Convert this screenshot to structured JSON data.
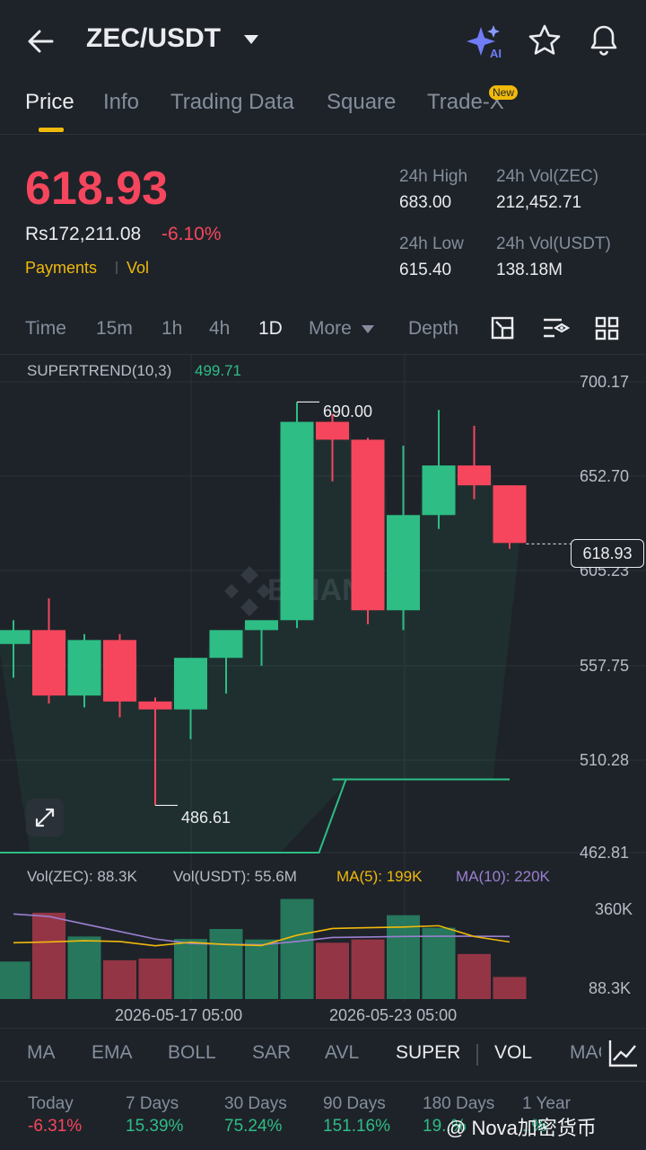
{
  "header": {
    "pair": "ZEC/USDT"
  },
  "tabs": [
    {
      "label": "Price",
      "active": true
    },
    {
      "label": "Info"
    },
    {
      "label": "Trading Data"
    },
    {
      "label": "Square"
    },
    {
      "label": "Trade-X",
      "badge": "New"
    }
  ],
  "summary": {
    "price": "618.93",
    "fiat": "Rs172,211.08",
    "change": "-6.10%",
    "tag_payments": "Payments",
    "tag_vol": "Vol",
    "stats": [
      {
        "label": "24h High",
        "value": "683.00"
      },
      {
        "label": "24h Vol(ZEC)",
        "value": "212,452.71"
      },
      {
        "label": "24h Low",
        "value": "615.40"
      },
      {
        "label": "24h Vol(USDT)",
        "value": "138.18M"
      }
    ]
  },
  "timeframes": [
    "Time",
    "15m",
    "1h",
    "4h",
    "1D",
    "More",
    "Depth"
  ],
  "active_timeframe": "1D",
  "chart": {
    "supertrend_label": "SUPERTREND(10,3)",
    "supertrend_value": "499.71",
    "price_ticks": [
      "700.17",
      "652.70",
      "605.23",
      "557.75",
      "510.28",
      "462.81"
    ],
    "current_price_label": "618.93",
    "high_label": "690.00",
    "low_label": "486.61",
    "watermark": "BINANCE",
    "vol_zec": "Vol(ZEC): 88.3K",
    "vol_usdt": "Vol(USDT): 55.6M",
    "ma5": "MA(5): 199K",
    "ma10": "MA(10): 220K",
    "vol_ticks": [
      "360K",
      "88.3K"
    ],
    "dates": [
      "2026-05-17 05:00",
      "2026-05-23 05:00"
    ],
    "colors": {
      "up": "#2ebd85",
      "down": "#f6465d",
      "ma5": "#f0b90b",
      "ma10": "#9b7fd1"
    }
  },
  "chart_data": {
    "type": "candlestick",
    "ylim": [
      462.81,
      700.17
    ],
    "candles": [
      {
        "o": 568,
        "h": 580,
        "l": 551,
        "c": 575
      },
      {
        "o": 575,
        "h": 591,
        "l": 538,
        "c": 542
      },
      {
        "o": 542,
        "h": 573,
        "l": 536,
        "c": 570
      },
      {
        "o": 570,
        "h": 573,
        "l": 531,
        "c": 539
      },
      {
        "o": 539,
        "h": 541,
        "l": 486.61,
        "c": 535
      },
      {
        "o": 535,
        "h": 556,
        "l": 520,
        "c": 561
      },
      {
        "o": 561,
        "h": 570,
        "l": 543,
        "c": 575
      },
      {
        "o": 575,
        "h": 579,
        "l": 557,
        "c": 580
      },
      {
        "o": 580,
        "h": 690.0,
        "l": 576,
        "c": 680
      },
      {
        "o": 680,
        "h": 684,
        "l": 650,
        "c": 671
      },
      {
        "o": 671,
        "h": 672,
        "l": 578,
        "c": 585
      },
      {
        "o": 585,
        "h": 668,
        "l": 575,
        "c": 633
      },
      {
        "o": 633,
        "h": 686,
        "l": 626,
        "c": 658
      },
      {
        "o": 658,
        "h": 678,
        "l": 641,
        "c": 648
      },
      {
        "o": 648,
        "h": 648,
        "l": 616,
        "c": 618.93
      }
    ],
    "supertrend": [
      462.81,
      462.81,
      462.81,
      462.81,
      462.81,
      462.81,
      462.81,
      462.81,
      462.81,
      499.71,
      499.71,
      499.71,
      499.71,
      499.71,
      499.71
    ],
    "volume_ylim": [
      0,
      420000
    ],
    "volumes": [
      150000,
      345000,
      250000,
      155000,
      162000,
      240000,
      280000,
      238000,
      400000,
      225000,
      238000,
      335000,
      285000,
      180000,
      88300
    ],
    "ma5": [
      225000,
      228000,
      233000,
      230000,
      213000,
      227000,
      218000,
      214000,
      255000,
      282000,
      285000,
      288000,
      293000,
      250000,
      228000
    ],
    "ma10": [
      340000,
      330000,
      300000,
      270000,
      240000,
      222000,
      219000,
      217000,
      230000,
      246000,
      248000,
      250000,
      251000,
      251000,
      250000
    ]
  },
  "indicators": [
    "MA",
    "EMA",
    "BOLL",
    "SAR",
    "AVL",
    "SUPER",
    "VOL",
    "MACD"
  ],
  "active_indicators": [
    "SUPER",
    "VOL"
  ],
  "performance": [
    {
      "label": "Today",
      "value": "-6.31%"
    },
    {
      "label": "7 Days",
      "value": "15.39%"
    },
    {
      "label": "30 Days",
      "value": "75.24%"
    },
    {
      "label": "90 Days",
      "value": "151.16%"
    },
    {
      "label": "180 Days",
      "value": "19..%"
    },
    {
      "label": "1 Year",
      "value": "..%"
    }
  ],
  "watermark_text": "@ Nova加密货币"
}
